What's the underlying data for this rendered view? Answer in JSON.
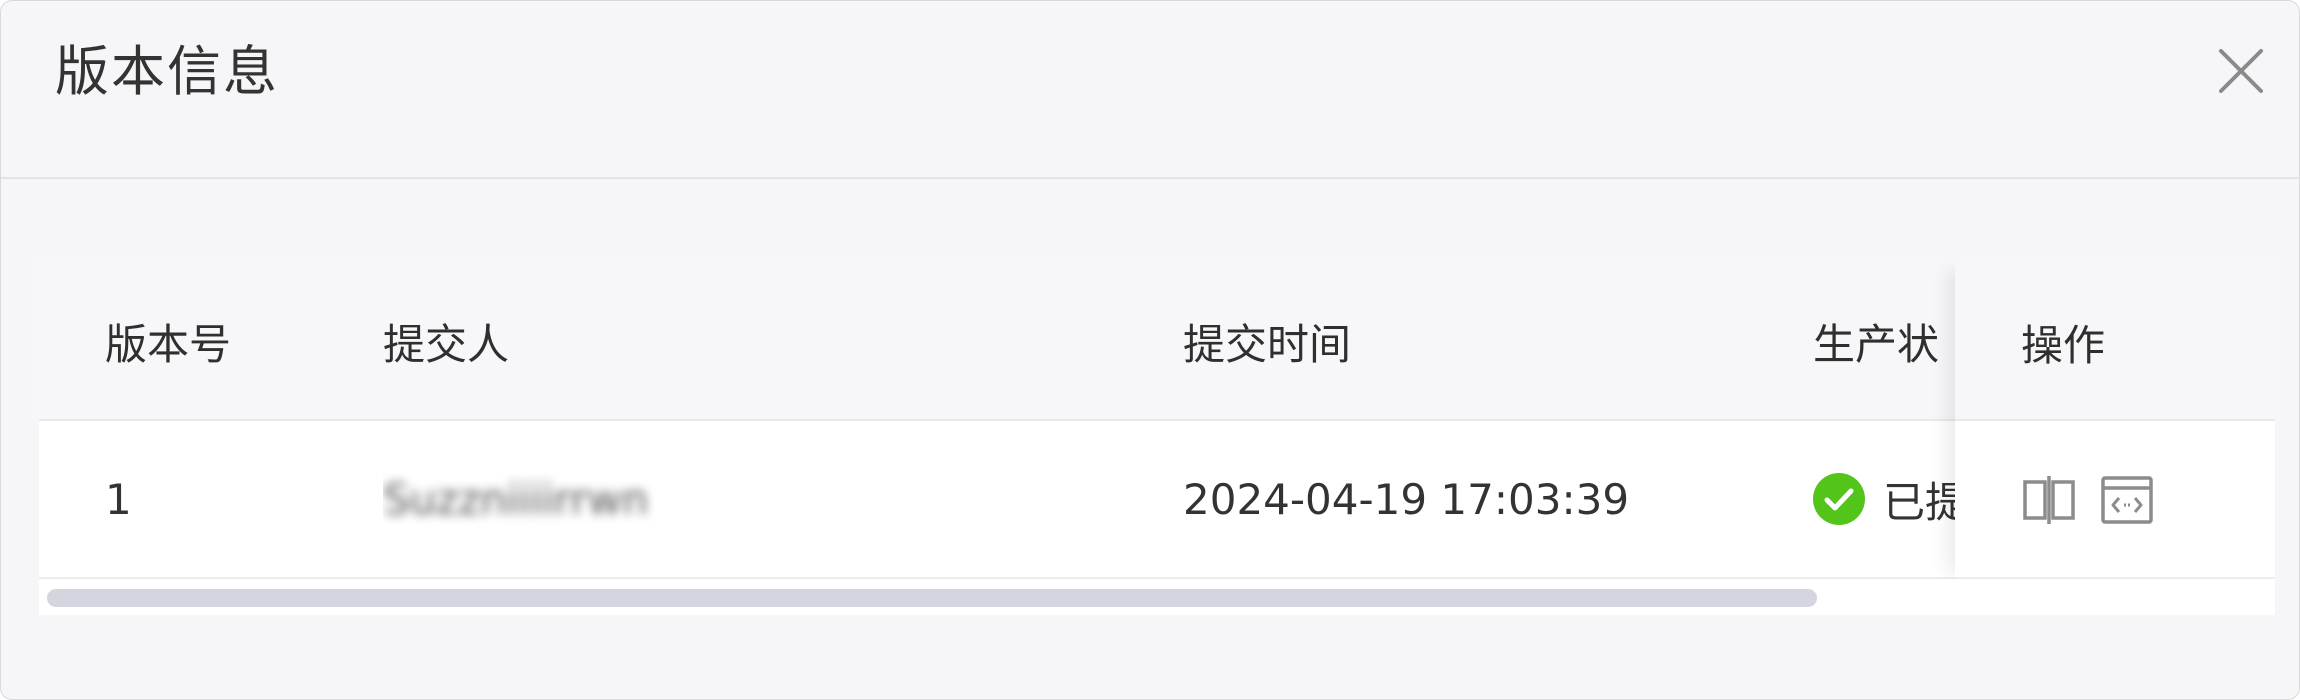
{
  "dialog": {
    "title": "版本信息",
    "close_icon": "close-icon"
  },
  "table": {
    "columns": [
      "版本号",
      "提交人",
      "提交时间",
      "生产状",
      "操作"
    ],
    "rows": [
      {
        "version": "1",
        "submitter": "Suzzniiiirrwn",
        "submit_time": "2024-04-19 17:03:39",
        "status_icon": "check-circle-icon",
        "status_text": "已提",
        "actions": [
          "compare-icon",
          "code-view-icon"
        ]
      }
    ]
  },
  "colors": {
    "status_success": "#52c41a",
    "icon_gray": "#8c8c8c",
    "scroll_thumb": "#d5d5e0"
  }
}
